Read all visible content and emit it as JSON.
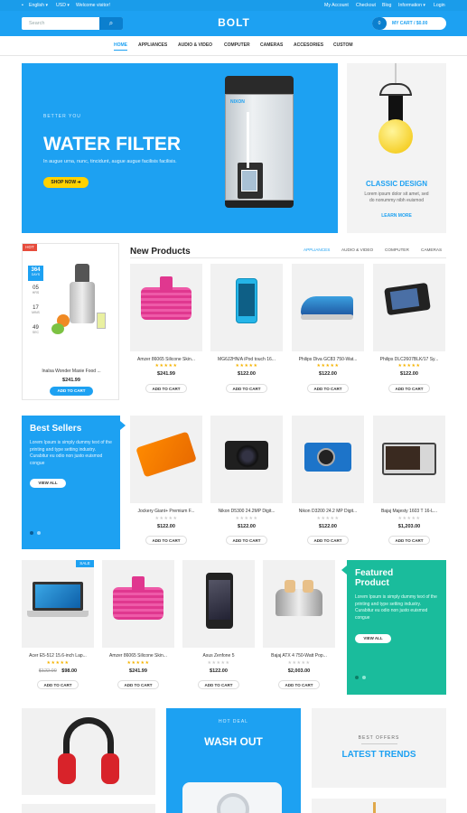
{
  "topbar": {
    "language": "English",
    "currency": "USD",
    "welcome": "Welcome visitor!",
    "my_account": "My Account",
    "checkout": "Checkout",
    "blog": "Blog",
    "information": "Information",
    "login": "Login"
  },
  "header": {
    "search_placeholder": "Search",
    "logo": "BOLT",
    "cart_count": "0",
    "cart_label": "MY CART / $0.00"
  },
  "nav": [
    "HOME",
    "APPLIANCES",
    "AUDIO & VIDEO",
    "COMPUTER",
    "CAMERAS",
    "ACCESORIES",
    "CUSTOM"
  ],
  "banner": {
    "kicker": "BETTER YOU",
    "title": "WATER FILTER",
    "text": "In augue urna, nunc, tincidunt, augue augue facilisis facilisis.",
    "button": "SHOP NOW",
    "product_label": "NIXON"
  },
  "side_banner": {
    "title": "CLASSIC DESIGN",
    "text": "Lorem ipsum dolor sit amet, sed do nonummy nibh euismod",
    "link": "LEARN MORE"
  },
  "deal": {
    "badge": "HOT",
    "days": "364",
    "days_label": "DAYS",
    "hours": "05",
    "hours_label": "HRS",
    "mins": "17",
    "mins_label": "MINS",
    "secs": "49",
    "secs_label": "SEC",
    "name": "Inalsa Wonder Maxie Food ...",
    "price": "$241.99",
    "button": "ADD TO CART"
  },
  "new_products": {
    "title": "New Products",
    "tabs": [
      "APPLIANCES",
      "AUDIO & VIDEO",
      "COMPUTER",
      "CAMERAS"
    ],
    "items": [
      {
        "name": "Amzer 86065 Silicone Skin...",
        "price": "$241.99",
        "button": "ADD TO CART"
      },
      {
        "name": "MG6J2HN/A iPod touch 16...",
        "price": "$122.00",
        "button": "ADD TO CART"
      },
      {
        "name": "Philips Diva GC83 750-Wat...",
        "price": "$122.00",
        "button": "ADD TO CART"
      },
      {
        "name": "Philips DLC2607BLK/17 Sy...",
        "price": "$122.00",
        "button": "ADD TO CART"
      }
    ]
  },
  "best_sellers": {
    "title": "Best Sellers",
    "text": "Lorem Ipsum is simply dummy text of the printing and type setting industry. Curabitur eu odio non justo euismod congue",
    "button": "VIEW ALL",
    "items": [
      {
        "name": "Jockery Giant+ Premium F...",
        "price": "$122.00",
        "button": "ADD TO CART"
      },
      {
        "name": "Nikon D5300 24.2MP Digit...",
        "price": "$122.00",
        "button": "ADD TO CART"
      },
      {
        "name": "Nikon D3200 24.2 MP Digit...",
        "price": "$122.00",
        "button": "ADD TO CART"
      },
      {
        "name": "Bajaj Majesty 1603 T 16-L...",
        "price": "$1,203.00",
        "button": "ADD TO CART"
      }
    ]
  },
  "featured": {
    "title1": "Featured",
    "title2": "Product",
    "text": "Lorem Ipsum is simply dummy text of the printing and type setting industry. Curabitur eu odio non justo euismod congue",
    "button": "VIEW ALL",
    "items": [
      {
        "badge": "SALE",
        "name": "Acer E5-512 15.6-inch Lap...",
        "old_price": "$122.00",
        "price": "$98.00",
        "button": "ADD TO CART"
      },
      {
        "badge": "",
        "name": "Amzer 86065 Silicone Skin...",
        "old_price": "",
        "price": "$241.99",
        "button": "ADD TO CART"
      },
      {
        "badge": "",
        "name": "Asus Zenfone 5",
        "old_price": "",
        "price": "$122.00",
        "button": "ADD TO CART"
      },
      {
        "badge": "",
        "name": "Bajaj ATX 4 750-Watt Pop...",
        "old_price": "",
        "price": "$2,003.00",
        "button": "ADD TO CART"
      }
    ]
  },
  "bottom": {
    "hot_deal_kicker": "HOT DEAL",
    "hot_deal_title": "WASH OUT",
    "offers_kicker": "BEST OFFERS",
    "offers_title": "LATEST TRENDS"
  },
  "colors": {
    "primary": "#1da1f2",
    "dark_primary": "#0b7fce",
    "teal": "#1abc9c",
    "hot": "#e74c3c",
    "star": "#f5b300"
  }
}
